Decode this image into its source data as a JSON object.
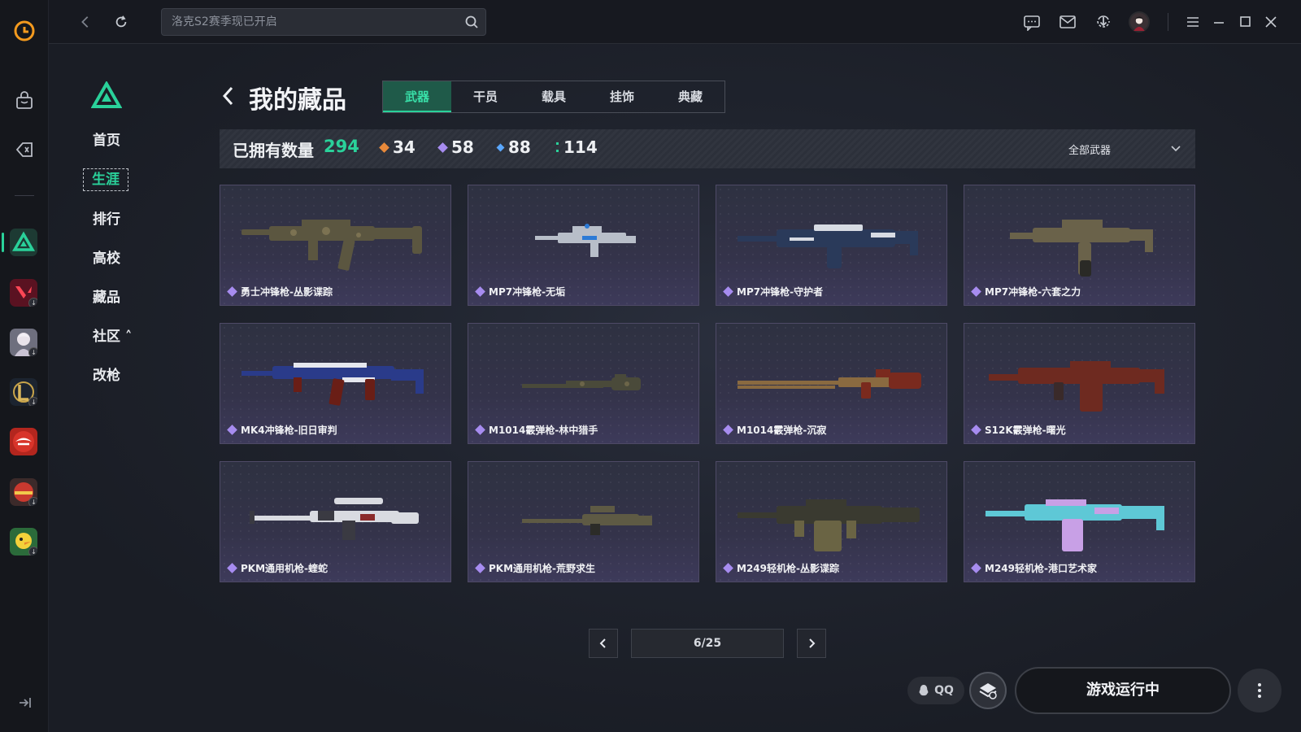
{
  "app": {
    "accent": "#2ad19a",
    "rarity_colors": {
      "orange": "#e8893a",
      "purple": "#a78cf0",
      "blue": "#5aa7ff",
      "teal": "#2ad19a"
    }
  },
  "topbar": {
    "search_placeholder": "洛克S2赛季现已开启",
    "icons": [
      "back-icon",
      "refresh-icon",
      "search-icon",
      "chat-icon",
      "mail-icon",
      "download-icon",
      "avatar",
      "menu-icon",
      "minimize-icon",
      "maximize-icon",
      "close-icon"
    ]
  },
  "sidebar": {
    "items": [
      {
        "label": "首页"
      },
      {
        "label": "生涯",
        "active": true
      },
      {
        "label": "排行"
      },
      {
        "label": "高校"
      },
      {
        "label": "藏品"
      },
      {
        "label": "社区 ˄"
      },
      {
        "label": "改枪"
      }
    ]
  },
  "header": {
    "title": "我的藏品",
    "tabs": [
      {
        "label": "武器",
        "active": true
      },
      {
        "label": "干员"
      },
      {
        "label": "载具"
      },
      {
        "label": "挂饰"
      },
      {
        "label": "典藏"
      }
    ]
  },
  "stats": {
    "owned_label": "已拥有数量",
    "total": "294",
    "counts": [
      {
        "value": "34",
        "color": "#e8893a"
      },
      {
        "value": "58",
        "color": "#a78cf0"
      },
      {
        "value": "88",
        "color": "#5aa7ff"
      },
      {
        "value": "114",
        "color": "#2ad19a"
      }
    ],
    "filter": "全部武器"
  },
  "items": [
    {
      "name": "勇士冲锋枪-丛影谍踪"
    },
    {
      "name": "MP7冲锋枪-无垢"
    },
    {
      "name": "MP7冲锋枪-守护者"
    },
    {
      "name": "MP7冲锋枪-六套之力"
    },
    {
      "name": "MK4冲锋枪-旧日审判"
    },
    {
      "name": "M1014霰弹枪-林中猎手"
    },
    {
      "name": "M1014霰弹枪-沉寂"
    },
    {
      "name": "S12K霰弹枪-曙光"
    },
    {
      "name": "PKM通用机枪-蝰蛇"
    },
    {
      "name": "PKM通用机枪-荒野求生"
    },
    {
      "name": "M249轻机枪-丛影谍踪"
    },
    {
      "name": "M249轻机枪-港口艺术家"
    }
  ],
  "pagination": {
    "text": "6/25"
  },
  "footer": {
    "qq_label": "QQ",
    "run_label": "游戏运行中"
  }
}
